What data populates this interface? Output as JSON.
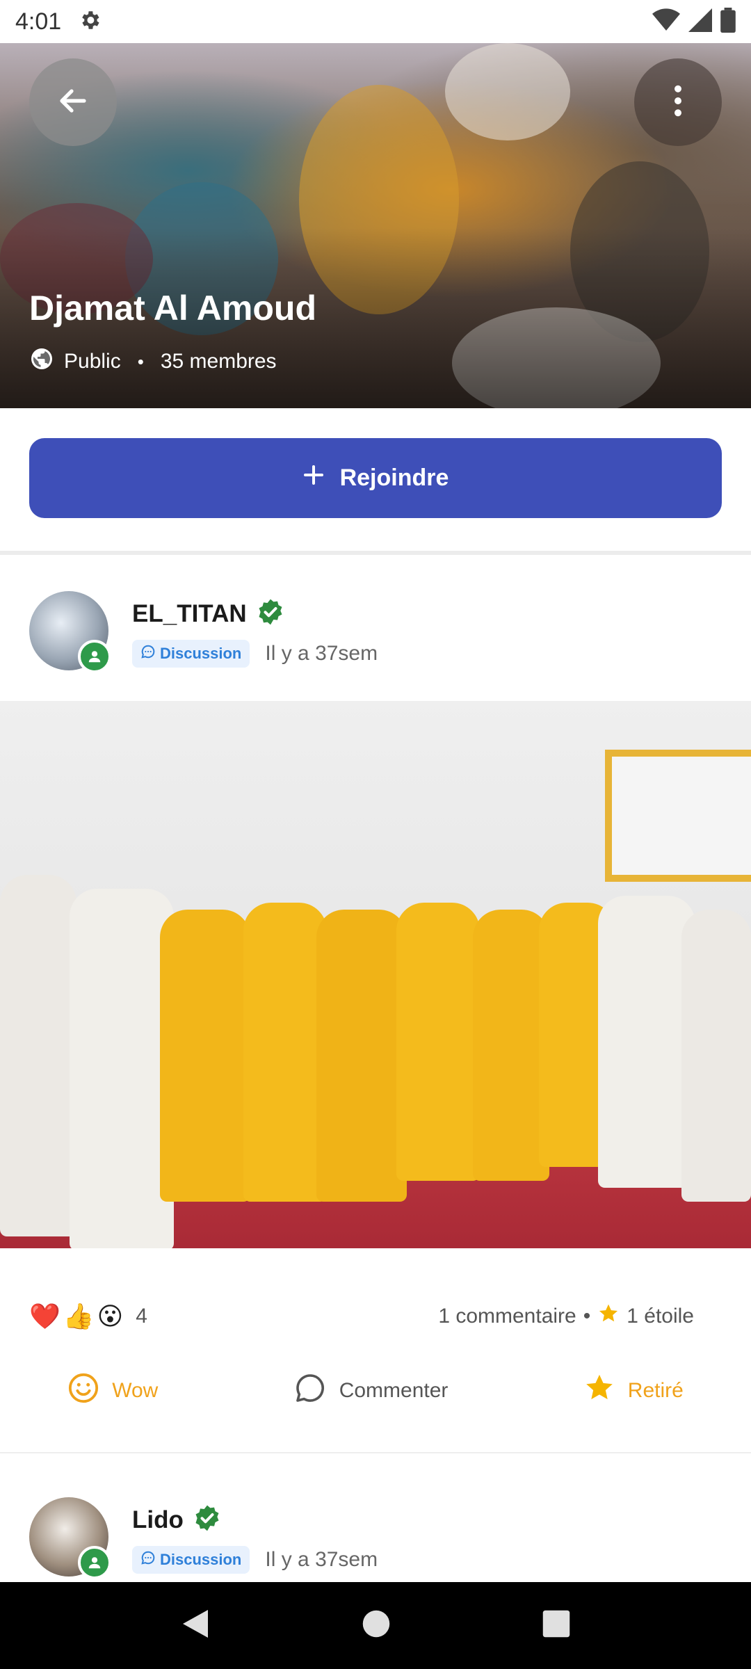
{
  "status_bar": {
    "time": "4:01"
  },
  "group": {
    "title": "Djamat Al Amoud",
    "privacy": "Public",
    "members": "35 membres"
  },
  "join_button": {
    "label": "Rejoindre"
  },
  "posts": [
    {
      "author": "EL_TITAN",
      "tag": "Discussion",
      "time": "Il y a 37sem",
      "reaction_count": "4",
      "comments": "1 commentaire",
      "stars": "1 étoile",
      "actions": {
        "reaction": "Wow",
        "comment": "Commenter",
        "star": "Retiré"
      }
    },
    {
      "author": "Lido",
      "tag": "Discussion",
      "time": "Il y a 37sem"
    }
  ],
  "colors": {
    "primary": "#3e4fb8",
    "verified": "#2e8b3e",
    "accent": "#f0a21b",
    "tag_text": "#2f80d9"
  },
  "icons": {
    "status": [
      "gear-icon",
      "wifi-icon",
      "signal-icon",
      "battery-icon"
    ],
    "cover": [
      "back-arrow-icon",
      "more-vertical-icon",
      "globe-icon"
    ],
    "post": [
      "verified-icon",
      "chat-icon",
      "heart-emoji",
      "thumbs-up-emoji",
      "wow-emoji",
      "star-icon",
      "smiley-icon",
      "comment-icon"
    ],
    "nav": [
      "back-triangle-icon",
      "home-circle-icon",
      "recents-square-icon"
    ]
  }
}
